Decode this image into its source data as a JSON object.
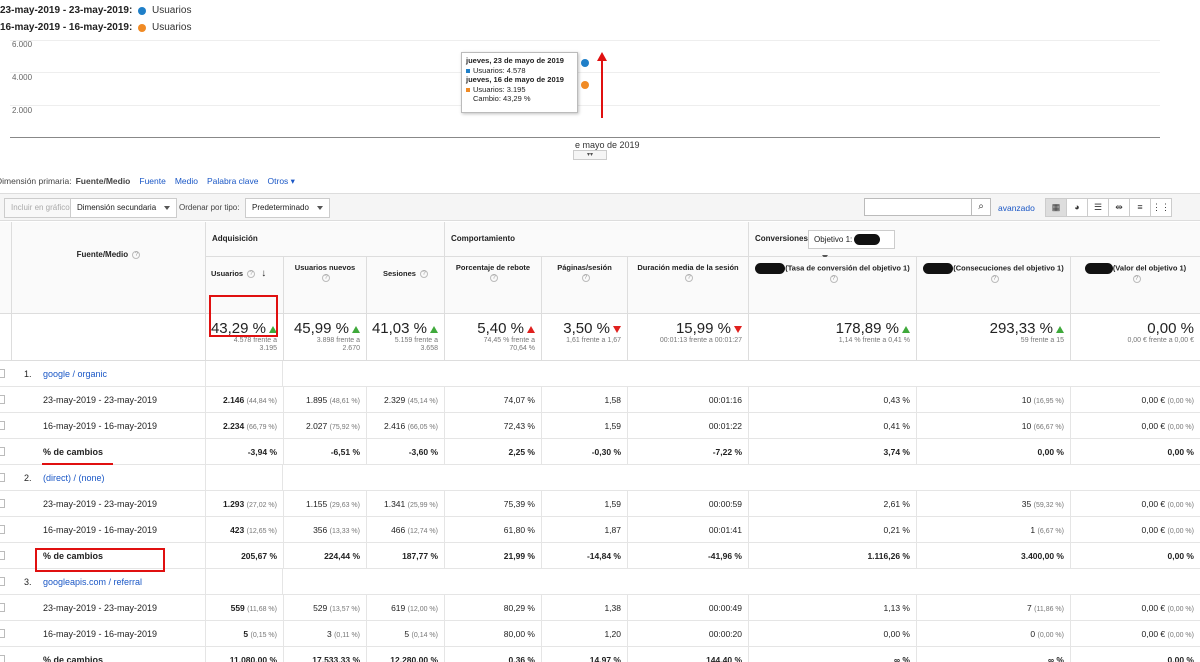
{
  "legend": [
    {
      "date": "23-may-2019 - 23-may-2019:",
      "label": "Usuarios",
      "color": "#1f7fc8"
    },
    {
      "date": "16-may-2019 - 16-may-2019:",
      "label": "Usuarios",
      "color": "#f08a24"
    }
  ],
  "chart": {
    "y_ticks": [
      "6.000",
      "4.000",
      "2.000"
    ],
    "x_label": "e mayo de 2019",
    "points": [
      {
        "series": "23-may-2019",
        "value": 4578,
        "color": "#1f7fc8"
      },
      {
        "series": "16-may-2019",
        "value": 3195,
        "color": "#f08a24"
      }
    ],
    "tooltip": {
      "date1": "jueves, 23 de mayo de 2019",
      "line1": "Usuarios: 4.578",
      "date2": "jueves, 16 de mayo de 2019",
      "line2": "Usuarios: 3.195",
      "change": "Cambio: 43,29 %"
    }
  },
  "dimension": {
    "label": "Dimensión primaria:",
    "selected": "Fuente/Medio",
    "options": [
      "Fuente",
      "Medio",
      "Palabra clave"
    ],
    "more": "Otros"
  },
  "toolbar": {
    "include_chart": "Incluir en gráfico",
    "secondary_dim": "Dimensión secundaria",
    "sort_label": "Ordenar por tipo:",
    "sort_value": "Predeterminado",
    "advanced": "avanzado",
    "search_value": ""
  },
  "groups": {
    "adquisicion": "Adquisición",
    "comportamiento": "Comportamiento",
    "conversiones": "Conversiones",
    "objetivo": "Objetivo 1:"
  },
  "columns": {
    "dim": "Fuente/Medio",
    "usuarios": "Usuarios",
    "nuevos": "Usuarios nuevos",
    "sesiones": "Sesiones",
    "rebote": "Porcentaje de rebote",
    "paginas": "Páginas/sesión",
    "duracion": "Duración media de la sesión",
    "tasa": "(Tasa de conversión del objetivo 1)",
    "consec": "(Consecuciones del objetivo 1)",
    "valor": "(Valor del objetivo 1)"
  },
  "summary": {
    "usuarios": {
      "big": "43,29 %",
      "dir": "up",
      "small1": "4.578 frente a",
      "small2": "3.195"
    },
    "nuevos": {
      "big": "45,99 %",
      "dir": "up",
      "small1": "3.898 frente a",
      "small2": "2.670"
    },
    "sesiones": {
      "big": "41,03 %",
      "dir": "up",
      "small1": "5.159 frente a",
      "small2": "3.658"
    },
    "rebote": {
      "big": "5,40 %",
      "dir": "down-bad",
      "small1": "74,45 % frente a",
      "small2": "70,64 %"
    },
    "paginas": {
      "big": "3,50 %",
      "dir": "down",
      "small1": "1,61 frente a 1,67",
      "small2": ""
    },
    "duracion": {
      "big": "15,99 %",
      "dir": "down",
      "small1": "00:01:13 frente a 00:01:27",
      "small2": ""
    },
    "tasa": {
      "big": "178,89 %",
      "dir": "up",
      "small1": "1,14 % frente a 0,41 %",
      "small2": ""
    },
    "consec": {
      "big": "293,33 %",
      "dir": "up",
      "small1": "59 frente a 15",
      "small2": ""
    },
    "valor": {
      "big": "0,00 %",
      "dir": "",
      "small1": "0,00 € frente a 0,00 €",
      "small2": ""
    }
  },
  "sources": [
    {
      "num": "1.",
      "name": "google / organic",
      "rows": [
        {
          "label": "23-may-2019 - 23-may-2019",
          "usuarios": "2.146",
          "usuarios_pct": "(44,84 %)",
          "nuevos": "1.895",
          "nuevos_pct": "(48,61 %)",
          "sesiones": "2.329",
          "sesiones_pct": "(45,14 %)",
          "rebote": "74,07 %",
          "paginas": "1,58",
          "duracion": "00:01:16",
          "tasa": "0,43 %",
          "consec": "10",
          "consec_pct": "(16,95 %)",
          "valor": "0,00 €",
          "valor_pct": "(0,00 %)"
        },
        {
          "label": "16-may-2019 - 16-may-2019",
          "usuarios": "2.234",
          "usuarios_pct": "(66,79 %)",
          "nuevos": "2.027",
          "nuevos_pct": "(75,92 %)",
          "sesiones": "2.416",
          "sesiones_pct": "(66,05 %)",
          "rebote": "72,43 %",
          "paginas": "1,59",
          "duracion": "00:01:22",
          "tasa": "0,41 %",
          "consec": "10",
          "consec_pct": "(66,67 %)",
          "valor": "0,00 €",
          "valor_pct": "(0,00 %)"
        },
        {
          "label": "% de cambios",
          "usuarios": "-3,94 %",
          "usuarios_pct": "",
          "nuevos": "-6,51 %",
          "nuevos_pct": "",
          "sesiones": "-3,60 %",
          "sesiones_pct": "",
          "rebote": "2,25 %",
          "paginas": "-0,30 %",
          "duracion": "-7,22 %",
          "tasa": "3,74 %",
          "consec": "0,00 %",
          "consec_pct": "",
          "valor": "0,00 %",
          "valor_pct": ""
        }
      ]
    },
    {
      "num": "2.",
      "name": "(direct) / (none)",
      "rows": [
        {
          "label": "23-may-2019 - 23-may-2019",
          "usuarios": "1.293",
          "usuarios_pct": "(27,02 %)",
          "nuevos": "1.155",
          "nuevos_pct": "(29,63 %)",
          "sesiones": "1.341",
          "sesiones_pct": "(25,99 %)",
          "rebote": "75,39 %",
          "paginas": "1,59",
          "duracion": "00:00:59",
          "tasa": "2,61 %",
          "consec": "35",
          "consec_pct": "(59,32 %)",
          "valor": "0,00 €",
          "valor_pct": "(0,00 %)"
        },
        {
          "label": "16-may-2019 - 16-may-2019",
          "usuarios": "423",
          "usuarios_pct": "(12,65 %)",
          "nuevos": "356",
          "nuevos_pct": "(13,33 %)",
          "sesiones": "466",
          "sesiones_pct": "(12,74 %)",
          "rebote": "61,80 %",
          "paginas": "1,87",
          "duracion": "00:01:41",
          "tasa": "0,21 %",
          "consec": "1",
          "consec_pct": "(6,67 %)",
          "valor": "0,00 €",
          "valor_pct": "(0,00 %)"
        },
        {
          "label": "% de cambios",
          "usuarios": "205,67 %",
          "usuarios_pct": "",
          "nuevos": "224,44 %",
          "nuevos_pct": "",
          "sesiones": "187,77 %",
          "sesiones_pct": "",
          "rebote": "21,99 %",
          "paginas": "-14,84 %",
          "duracion": "-41,96 %",
          "tasa": "1.116,26 %",
          "consec": "3.400,00 %",
          "consec_pct": "",
          "valor": "0,00 %",
          "valor_pct": ""
        }
      ]
    },
    {
      "num": "3.",
      "name": "googleapis.com / referral",
      "rows": [
        {
          "label": "23-may-2019 - 23-may-2019",
          "usuarios": "559",
          "usuarios_pct": "(11,68 %)",
          "nuevos": "529",
          "nuevos_pct": "(13,57 %)",
          "sesiones": "619",
          "sesiones_pct": "(12,00 %)",
          "rebote": "80,29 %",
          "paginas": "1,38",
          "duracion": "00:00:49",
          "tasa": "1,13 %",
          "consec": "7",
          "consec_pct": "(11,86 %)",
          "valor": "0,00 €",
          "valor_pct": "(0,00 %)"
        },
        {
          "label": "16-may-2019 - 16-may-2019",
          "usuarios": "5",
          "usuarios_pct": "(0,15 %)",
          "nuevos": "3",
          "nuevos_pct": "(0,11 %)",
          "sesiones": "5",
          "sesiones_pct": "(0,14 %)",
          "rebote": "80,00 %",
          "paginas": "1,20",
          "duracion": "00:00:20",
          "tasa": "0,00 %",
          "consec": "0",
          "consec_pct": "(0,00 %)",
          "valor": "0,00 €",
          "valor_pct": "(0,00 %)"
        },
        {
          "label": "% de cambios",
          "usuarios": "11.080,00 %",
          "usuarios_pct": "",
          "nuevos": "17.533,33 %",
          "nuevos_pct": "",
          "sesiones": "12.280,00 %",
          "sesiones_pct": "",
          "rebote": "0,36 %",
          "paginas": "14,97 %",
          "duracion": "144,40 %",
          "tasa": "∞ %",
          "consec": "∞ %",
          "consec_pct": "",
          "valor": "0,00 %",
          "valor_pct": ""
        }
      ]
    }
  ]
}
